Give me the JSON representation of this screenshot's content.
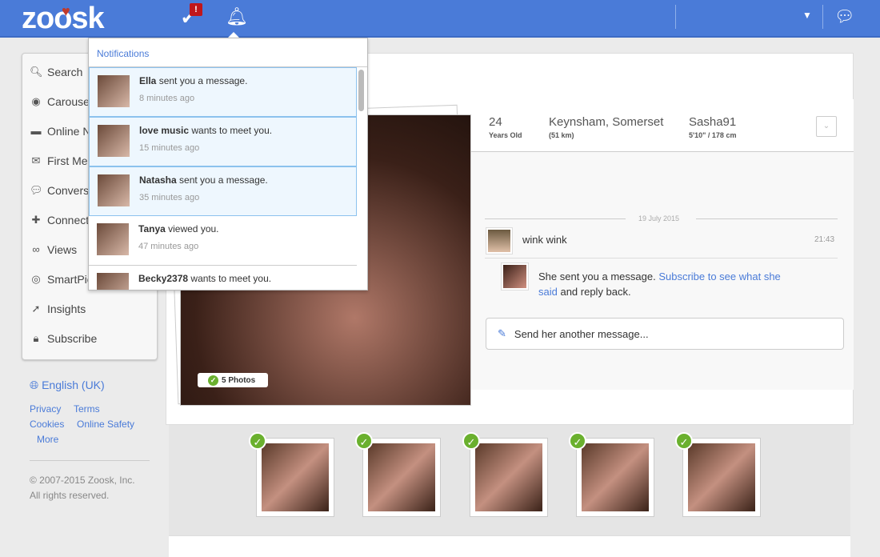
{
  "header": {
    "logo": "zoosk",
    "alert_badge": "!",
    "accent": "#4a7bd8"
  },
  "sidebar": {
    "items": [
      {
        "label": "Search",
        "icon": "search-icon"
      },
      {
        "label": "Carousel",
        "icon": "carousel-icon"
      },
      {
        "label": "Online Now",
        "icon": "online-icon"
      },
      {
        "label": "First Message",
        "icon": "envelope-icon"
      },
      {
        "label": "Conversations",
        "icon": "chat-icon"
      },
      {
        "label": "Connections",
        "icon": "add-user-icon"
      },
      {
        "label": "Views",
        "icon": "glasses-icon"
      },
      {
        "label": "SmartPick",
        "icon": "target-icon"
      },
      {
        "label": "Insights",
        "icon": "insights-icon"
      },
      {
        "label": "Subscribe",
        "icon": "lock-icon"
      }
    ]
  },
  "footer": {
    "language": "English (UK)",
    "links": [
      "Privacy",
      "Terms",
      "Cookies",
      "Online Safety",
      "More"
    ],
    "copyright": "© 2007-2015 Zoosk, Inc.",
    "rights": "All rights reserved."
  },
  "notifications": {
    "title": "Notifications",
    "items": [
      {
        "name": "Ella",
        "text": " sent you a message.",
        "time": "8 minutes ago",
        "unread": true
      },
      {
        "name": "love music",
        "text": " wants to meet you.",
        "time": "15 minutes ago",
        "unread": true
      },
      {
        "name": "Natasha",
        "text": " sent you a message.",
        "time": "35 minutes ago",
        "unread": true
      },
      {
        "name": "Tanya",
        "text": " viewed you.",
        "time": "47 minutes ago",
        "unread": false
      },
      {
        "name": "Becky2378",
        "text": " wants to meet you.",
        "time": "",
        "unread": false
      }
    ]
  },
  "profile": {
    "age": "24",
    "age_label": "Years Old",
    "location": "Keynsham, Somerset",
    "distance": "(51 km)",
    "username": "Sasha91",
    "height": "5'10\" / 178 cm",
    "photos_label": "5 Photos"
  },
  "conversation": {
    "date": "19 July 2015",
    "my_message": "wink wink",
    "my_time": "21:43",
    "her_prefix": "She sent you a message. ",
    "her_link": "Subscribe to see what she said",
    "her_suffix": " and reply back.",
    "input_placeholder": "Send her another message..."
  }
}
